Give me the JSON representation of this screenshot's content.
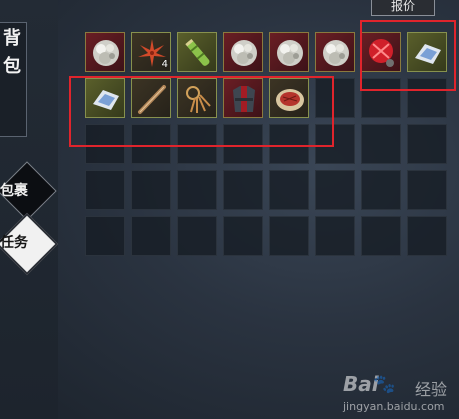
{
  "side_panel": {
    "title_chars": [
      "背",
      "包"
    ],
    "tab_bag": "包裹",
    "tab_quest": "任务"
  },
  "top_bar": {
    "price_button": "报价"
  },
  "inventory": {
    "rows": 5,
    "cols": 8,
    "items": [
      {
        "name": "silver-ore-icon",
        "qty": ""
      },
      {
        "name": "maple-leaf-icon",
        "qty": "4"
      },
      {
        "name": "bamboo-tube-icon",
        "qty": ""
      },
      {
        "name": "silver-ore-icon",
        "qty": ""
      },
      {
        "name": "silver-ore-icon",
        "qty": ""
      },
      {
        "name": "silver-ore-icon",
        "qty": ""
      },
      {
        "name": "red-gift-bundle-icon",
        "qty": ""
      },
      {
        "name": "salt-bag-icon",
        "qty": ""
      },
      {
        "name": "salt-bag-icon",
        "qty": ""
      },
      {
        "name": "wooden-staff-icon",
        "qty": ""
      },
      {
        "name": "key-ring-icon",
        "qty": ""
      },
      {
        "name": "armor-robe-icon",
        "qty": ""
      },
      {
        "name": "meat-plate-icon",
        "qty": ""
      }
    ]
  },
  "watermark": {
    "logo": "Bai",
    "paw": "🐾",
    "jingyan": "经验",
    "url": "jingyan.baidu.com"
  },
  "colors": {
    "highlight": "#e0242c",
    "slot_border_filled": "#87914e"
  }
}
